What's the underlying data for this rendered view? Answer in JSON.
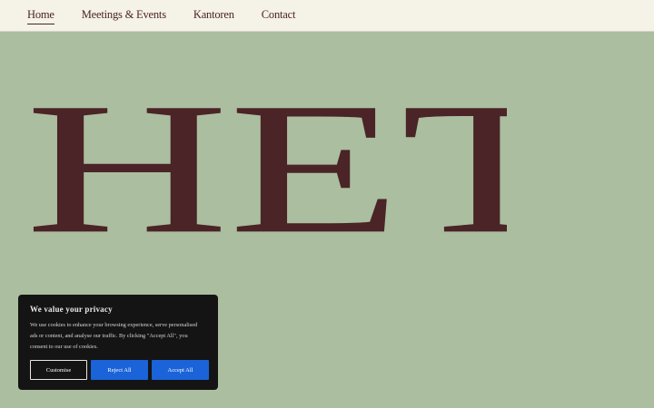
{
  "nav": {
    "items": [
      {
        "label": "Home"
      },
      {
        "label": "Meetings & Events"
      },
      {
        "label": "Kantoren"
      },
      {
        "label": "Contact"
      }
    ]
  },
  "hero": {
    "title": "HETNOTARISHUIS",
    "color": "#4a2426"
  },
  "colors": {
    "page_background": "#abbe9f",
    "topbar_background": "#f5f2e7",
    "accent_button": "#1a63d8",
    "banner_background": "#141414"
  },
  "cookie_banner": {
    "title": "We value your privacy",
    "text": "We use cookies to enhance your browsing experience, serve personalised ads or content, and analyse our traffic. By clicking \"Accept All\", you consent to our use of cookies.",
    "customise_label": "Customise",
    "reject_label": "Reject All",
    "accept_label": "Accept All"
  }
}
